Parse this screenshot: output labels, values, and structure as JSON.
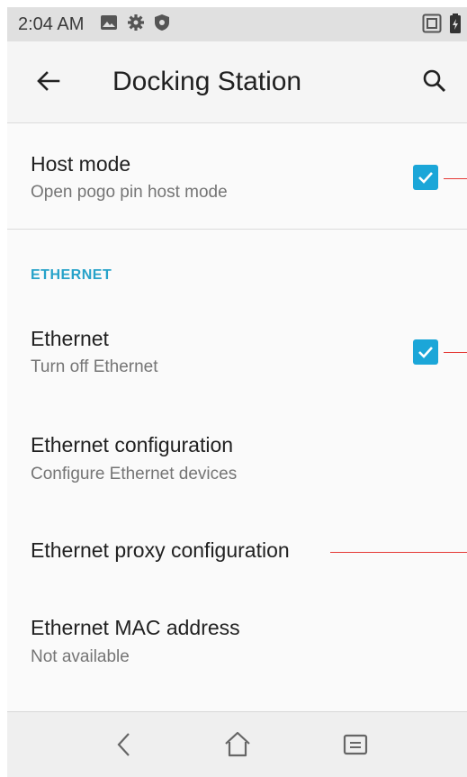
{
  "status_bar": {
    "time": "2:04 AM",
    "left_icons": [
      "image-icon",
      "gear-icon",
      "shield-icon"
    ],
    "right_icons": [
      "nfc-icon",
      "battery-icon"
    ]
  },
  "app_bar": {
    "title": "Docking Station",
    "back_icon": "arrow-back-icon",
    "search_icon": "search-icon"
  },
  "preferences": {
    "host_mode": {
      "title": "Host mode",
      "summary": "Open pogo pin host mode",
      "checked": true
    },
    "ethernet_category": "ETHERNET",
    "ethernet": {
      "title": "Ethernet",
      "summary": "Turn off Ethernet",
      "checked": true
    },
    "ethernet_config": {
      "title": "Ethernet configuration",
      "summary": "Configure Ethernet devices"
    },
    "ethernet_proxy": {
      "title": "Ethernet proxy configuration"
    },
    "ethernet_mac": {
      "title": "Ethernet MAC address",
      "summary": "Not available"
    }
  },
  "nav_bar": {
    "buttons": [
      "back-nav-icon",
      "home-nav-icon",
      "recents-nav-icon"
    ]
  },
  "colors": {
    "accent": "#1ba6d8",
    "category": "#26a2c9",
    "annotation": "#e53935"
  }
}
